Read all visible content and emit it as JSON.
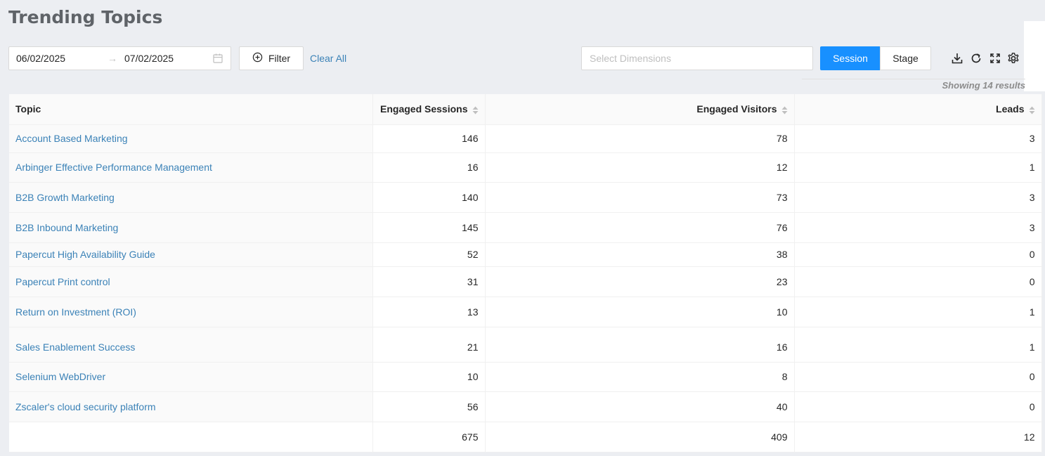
{
  "page": {
    "title": "Trending Topics"
  },
  "date_range": {
    "start": "06/02/2025",
    "separator": "→",
    "end": "07/02/2025"
  },
  "toolbar": {
    "filter_label": "Filter",
    "clear_all_label": "Clear All",
    "dimensions_placeholder": "Select Dimensions",
    "view_toggle": {
      "options": [
        "Session",
        "Stage"
      ],
      "selected": "Session"
    },
    "icons": [
      "download-icon",
      "refresh-icon",
      "fullscreen-icon",
      "settings-icon"
    ]
  },
  "results": {
    "showing_text": "Showing 14 results"
  },
  "table": {
    "columns": [
      "Topic",
      "Engaged Sessions",
      "Engaged Visitors",
      "Leads"
    ],
    "rows": [
      {
        "topic": "Account Based Marketing",
        "sessions": "146",
        "visitors": "78",
        "leads": "3"
      },
      {
        "topic": "Arbinger Effective Performance Management",
        "sessions": "16",
        "visitors": "12",
        "leads": "1"
      },
      {
        "topic": "B2B Growth Marketing",
        "sessions": "140",
        "visitors": "73",
        "leads": "3"
      },
      {
        "topic": "B2B Inbound Marketing",
        "sessions": "145",
        "visitors": "76",
        "leads": "3"
      },
      {
        "topic": "Papercut High Availability Guide",
        "sessions": "52",
        "visitors": "38",
        "leads": "0"
      },
      {
        "topic": "Papercut Print control",
        "sessions": "31",
        "visitors": "23",
        "leads": "0"
      },
      {
        "topic": "Return on Investment (ROI)",
        "sessions": "13",
        "visitors": "10",
        "leads": "1"
      },
      {
        "topic": "Sales Enablement Success",
        "sessions": "21",
        "visitors": "16",
        "leads": "1"
      },
      {
        "topic": "Selenium WebDriver",
        "sessions": "10",
        "visitors": "8",
        "leads": "0"
      },
      {
        "topic": "Zscaler's cloud security platform",
        "sessions": "56",
        "visitors": "40",
        "leads": "0"
      }
    ],
    "totals": {
      "sessions": "675",
      "visitors": "409",
      "leads": "12"
    }
  },
  "colors": {
    "accent": "#1890FF",
    "link": "#3B82B7",
    "background": "#ECEEF2"
  }
}
